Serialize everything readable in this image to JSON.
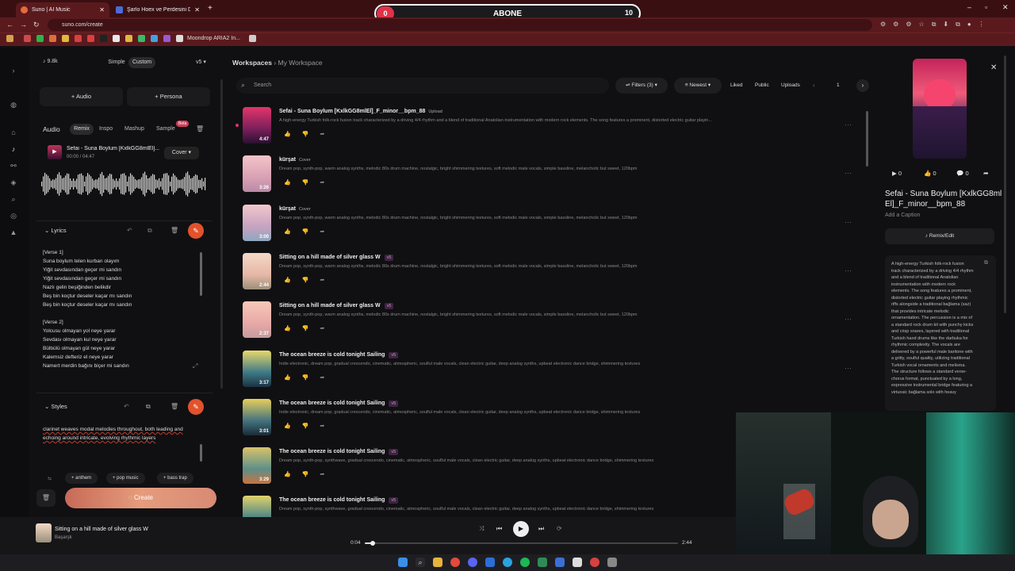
{
  "browser": {
    "tabs": [
      {
        "label": "Suno | AI Music",
        "active": true
      },
      {
        "label": "Şarlo Hoex ve Perdesini Değişti",
        "active": false
      }
    ],
    "url": "suno.com/create",
    "bookmark_label": "Moondrop ARIA2 In..."
  },
  "overlay": {
    "left_count": "0",
    "label": "ABONE",
    "right_count": "10"
  },
  "left": {
    "credits": "9.8k",
    "mode_simple": "Simple",
    "mode_custom": "Custom",
    "version": "v5",
    "add_audio": "Audio",
    "add_persona": "Persona",
    "tabs": [
      "Audio",
      "Remix",
      "Inspo",
      "Mashup",
      "Sample"
    ],
    "beta": "Beta",
    "clip_title": "Sefai - Suna Boylum [KxlkGG8mlEl]...",
    "clip_time": "00:00 / 04:47",
    "clip_mode": "Cover",
    "lyrics_title": "Lyrics",
    "lyrics": [
      "[Verse 1]",
      "Suna boylum telen kurban olayım",
      "Yiğit sevdasından geçer mi sandın",
      "Yiğit sevdasından geçer mi sandın",
      "Nazlı gelin beşiğinden belikdir",
      "Beş bin koçtur deseler kaçar mı sandın",
      "Beş bin koçtur deseler kaçar mı sandın",
      "",
      "[Verse 2]",
      "Yolcusu olmayan yol neye yarar",
      "Sevdası olmayan kul neye yarar",
      "Bülbülü olmayan gül neye yarar",
      "Kalemsiz defteriz el neye yarar",
      "Namert merdin bağını biçer mi sandın"
    ],
    "styles_title": "Styles",
    "styles_text": "clarinet weaves modal melodies throughout, both leading and echoing around intricate, evolving rhythmic layers",
    "chips": [
      "+ anthem",
      "+ pop music",
      "+ bass trap"
    ],
    "create": "Create"
  },
  "center": {
    "breadcrumb_root": "Workspaces",
    "breadcrumb_current": "My Workspace",
    "search_placeholder": "Search",
    "filters": "Filters (3)",
    "sort": "Newest",
    "liked": "Liked",
    "public": "Public",
    "uploads": "Uploads",
    "page": "1",
    "songs": [
      {
        "title": "Sefai - Suna Boylum [KxlkGG8mlEl]_F_minor__bpm_88",
        "tag": "Upload",
        "tagtype": "plain",
        "desc": "A high-energy Turkish folk-rock fusion track characterized by a driving 4/4 rhythm and a blend of traditional Anatolian instrumentation with modern rock elements. The song features a prominent, distorted electric guitar playin...",
        "dur": "4:47",
        "colors": [
          "#e4356a",
          "#7a1f5a",
          "#2a1030"
        ]
      },
      {
        "title": "kürşat",
        "tag": "Cover",
        "tagtype": "plain",
        "desc": "Dream pop, synth-pop, warm analog synths, melodic 80s drum machine, nostalgic, bright shimmering textures, soft melodic male vocals, simple bassline, melancholic but sweet, 120bpm",
        "dur": "3:26",
        "colors": [
          "#f3c4c9",
          "#d9a1b4",
          "#b98aa6"
        ]
      },
      {
        "title": "kürşat",
        "tag": "Cover",
        "tagtype": "plain",
        "desc": "Dream pop, synth-pop, warm analog synths, melodic 80s drum machine, nostalgic, bright shimmering textures, soft melodic male vocals, simple bassline, melancholic but sweet, 120bpm",
        "dur": "3:00",
        "colors": [
          "#f2c8cc",
          "#c6a3c0",
          "#8fa6bf"
        ]
      },
      {
        "title": "Sitting on a hill made of silver glass W",
        "tag": "v5",
        "tagtype": "v",
        "desc": "Dream pop, synth-pop, warm analog synths, melodic 80s drum machine, nostalgic, bright shimmering textures, soft melodic male vocals, simple bassline, melancholic but sweet, 120bpm",
        "dur": "2:44",
        "colors": [
          "#f4d9c8",
          "#e6b7a6",
          "#9a8f7a"
        ]
      },
      {
        "title": "Sitting on a hill made of silver glass W",
        "tag": "v5",
        "tagtype": "v",
        "desc": "Dream pop, synth-pop, warm analog synths, melodic 80s drum machine, nostalgic, bright shimmering textures, soft melodic male vocals, simple bassline, melancholic but sweet, 120bpm",
        "dur": "2:37",
        "colors": [
          "#f6c9b9",
          "#e8a9a6",
          "#c49a9f"
        ]
      },
      {
        "title": "The ocean breeze is cold tonight Sailing",
        "tag": "v5",
        "tagtype": "v",
        "desc": "Indie electronic, dream pop, gradual crescendo, cinematic, atmospheric, soulful male vocals, clean electric guitar, deep analog synths, upbeat electronic dance bridge, shimmering textures",
        "dur": "3:17",
        "colors": [
          "#e9d86a",
          "#3f7a86",
          "#1b3142"
        ]
      },
      {
        "title": "The ocean breeze is cold tonight Sailing",
        "tag": "v5",
        "tagtype": "v",
        "desc": "Indie electronic, dream pop, gradual crescendo, cinematic, atmospheric, soulful male vocals, clean electric guitar, deep analog synths, upbeat electronic dance bridge, shimmering textures",
        "dur": "3:01",
        "colors": [
          "#e6cf5c",
          "#44727e",
          "#1a2b38"
        ]
      },
      {
        "title": "The ocean breeze is cold tonight Sailing",
        "tag": "v5",
        "tagtype": "v",
        "desc": "Dream pop, synth-pop, synthwave, gradual crescendo, cinematic, atmospheric, soulful male vocals, clean electric guitar, deep analog synths, upbeat electronic dance bridge, shimmering textures",
        "dur": "3:29",
        "colors": [
          "#d9c36a",
          "#5d8f8a",
          "#c9733f"
        ]
      },
      {
        "title": "The ocean breeze is cold tonight Sailing",
        "tag": "v5",
        "tagtype": "v",
        "desc": "Dream pop, synth-pop, synthwave, gradual crescendo, cinematic, atmospheric, soulful male vocals, clean electric guitar, deep analog synths, upbeat electronic dance bridge, shimmering textures",
        "dur": "",
        "colors": [
          "#e2d26a",
          "#4b8486",
          "#22323f"
        ]
      }
    ]
  },
  "right": {
    "plays": "0",
    "likes": "0",
    "comments": "0",
    "title": "Sefai - Suna Boylum [KxlkGG8mlEl]_F_minor__bpm_88",
    "caption": "Add a Caption",
    "remix": "Remix/Edit",
    "description": "A high-energy Turkish folk-rock fusion track characterized by a driving 4/4 rhythm and a blend of traditional Anatolian instrumentation with modern rock elements. The song features a prominent, distorted electric guitar playing rhythmic riffs alongside a traditional bağlama (saz) that provides intricate melodic ornamentation. The percussion is a mix of a standard rock drum kit with punchy kicks and crisp snares, layered with traditional Turkish hand drums like the darbuka for rhythmic complexity. The vocals are delivered by a powerful male baritone with a gritty, soulful quality, utilizing traditional Turkish vocal ornaments and melisma. The structure follows a standard verse-chorus format, punctuated by a long, expressive instrumental bridge featuring a virtuosic bağlama solo with heavy"
  },
  "player": {
    "title": "Sitting on a hill made of silver glass W",
    "artist": "Başarşk",
    "current": "0:04",
    "total": "2:44",
    "progress": 0.025
  }
}
